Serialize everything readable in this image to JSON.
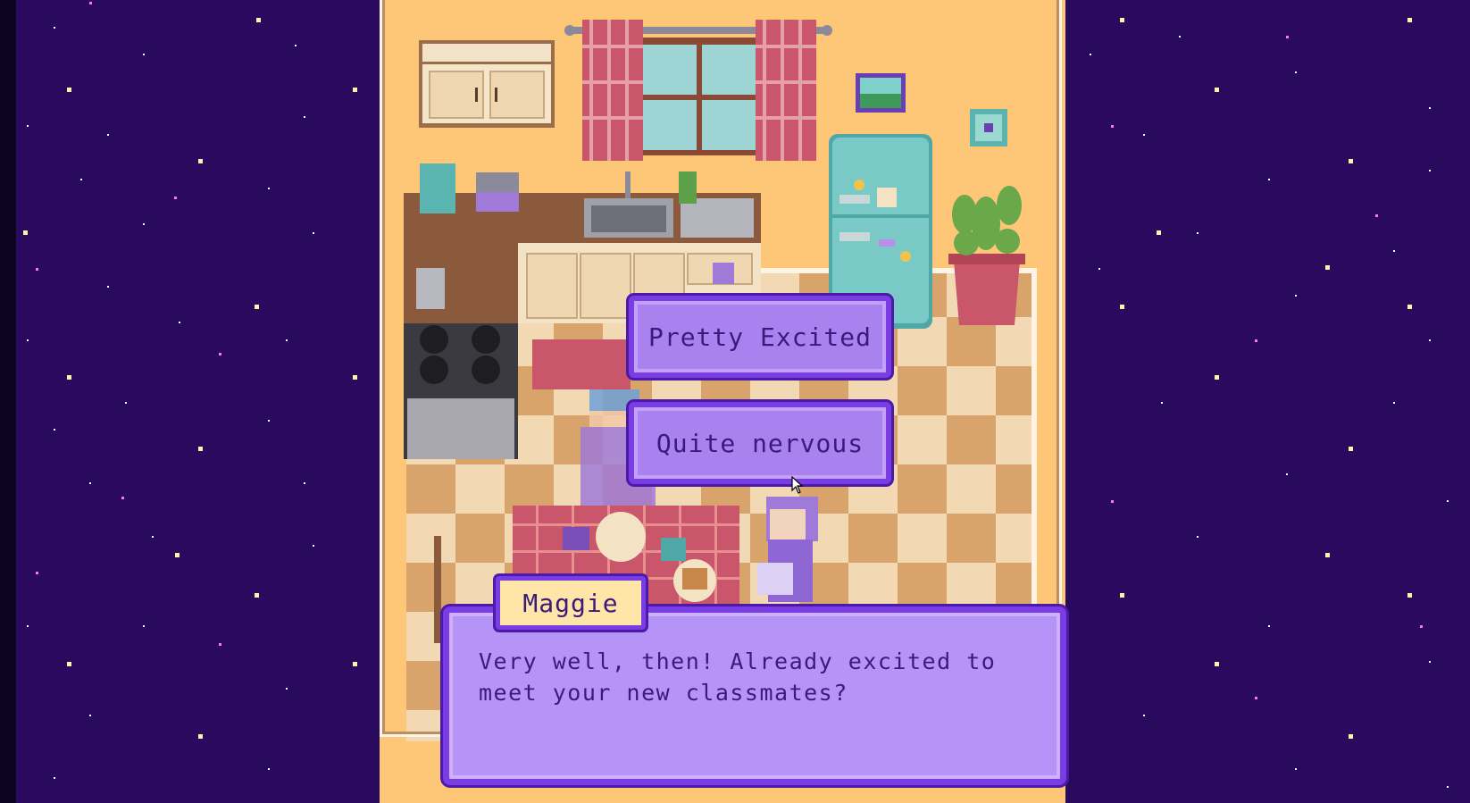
{
  "colors": {
    "sky": "#2a0a5e",
    "wall": "#fdc777",
    "ui_fill": "#a982f0",
    "ui_border": "#7a3de3",
    "ui_text": "#3b1a7a",
    "name_tag_fill": "#ffe6a8"
  },
  "choices": [
    {
      "label": "Pretty Excited"
    },
    {
      "label": "Quite nervous"
    }
  ],
  "dialog": {
    "speaker": "Maggie",
    "text": "Very well, then! Already excited to\nmeet your new classmates?"
  },
  "icons": {
    "cursor": "arrow-cursor-icon"
  }
}
